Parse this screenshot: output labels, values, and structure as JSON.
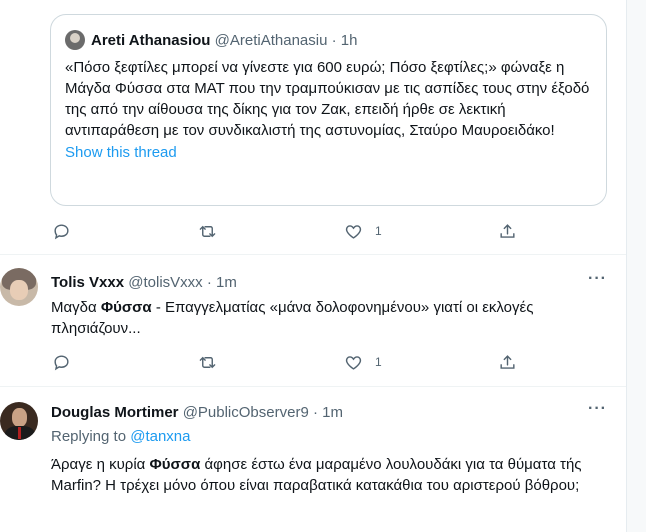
{
  "quoted": {
    "name": "Areti Athanasiou",
    "handle": "@AretiAthanasiu",
    "sep": "·",
    "time": "1h",
    "text": "«Πόσο ξεφτίλες μπορεί να γίνεστε για 600 ευρώ; Πόσο ξεφτίλες;» φώναξε η Μάγδα Φύσσα στα ΜΑΤ που την τραμπούκισαν με τις ασπίδες τους στην έξοδό της από την αίθουσα της δίκης για τον Ζακ, επειδή ήρθε σε λεκτική αντιπαράθεση με τον συνδικαλιστή της αστυνομίας, Σταύρο Μαυροειδάκο!",
    "show_thread": "Show this thread"
  },
  "quoted_actions": {
    "like_count": "1"
  },
  "tweets": [
    {
      "name": "Tolis Vxxx",
      "handle": "@tolisVxxx",
      "sep": "·",
      "time": "1m",
      "more": "···",
      "text_pre": "Μαγδα ",
      "text_bold": "Φύσσα",
      "text_post": " - Επαγγελματίας «μάνα δολοφονημένου» γιατί οι εκλογές πλησιάζουν...",
      "like_count": "1"
    },
    {
      "name": "Douglas Mortimer",
      "handle": "@PublicObserver9",
      "sep": "·",
      "time": "1m",
      "more": "···",
      "replying_label": "Replying to",
      "replying_to": "@tanxna",
      "text_pre": "Άραγε η κυρία ",
      "text_bold": "Φύσσα",
      "text_post": " άφησε έστω ένα μαραμένο λουλουδάκι για τα θύματα τής Marfin? Η τρέχει μόνο όπου είναι παραβατικά κατακάθια του αριστερού  βόθρου;"
    }
  ],
  "colors": {
    "link": "#1d9bf0",
    "muted": "#536471",
    "border": "#cfd9de"
  }
}
